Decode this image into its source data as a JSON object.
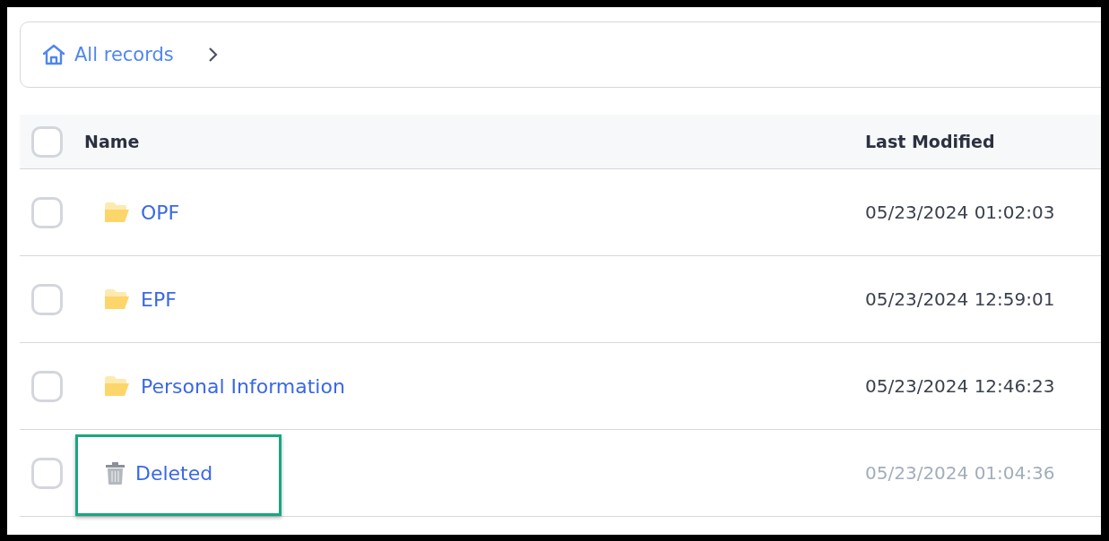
{
  "breadcrumb": {
    "items": [
      {
        "label": "All records",
        "kind": "home"
      }
    ]
  },
  "table": {
    "header": {
      "checked": false
    },
    "columns": [
      "Name",
      "Last Modified"
    ],
    "rows": [
      {
        "kind": "folder",
        "name": "OPF",
        "modified": "05/23/2024 01:02:03",
        "checked": false,
        "dimmed": false,
        "highlighted": false
      },
      {
        "kind": "folder",
        "name": "EPF",
        "modified": "05/23/2024 12:59:01",
        "checked": false,
        "dimmed": false,
        "highlighted": false
      },
      {
        "kind": "folder",
        "name": "Personal Information",
        "modified": "05/23/2024 12:46:23",
        "checked": false,
        "dimmed": false,
        "highlighted": false
      },
      {
        "kind": "trash",
        "name": "Deleted",
        "modified": "05/23/2024 01:04:36",
        "checked": false,
        "dimmed": true,
        "highlighted": true
      }
    ]
  }
}
